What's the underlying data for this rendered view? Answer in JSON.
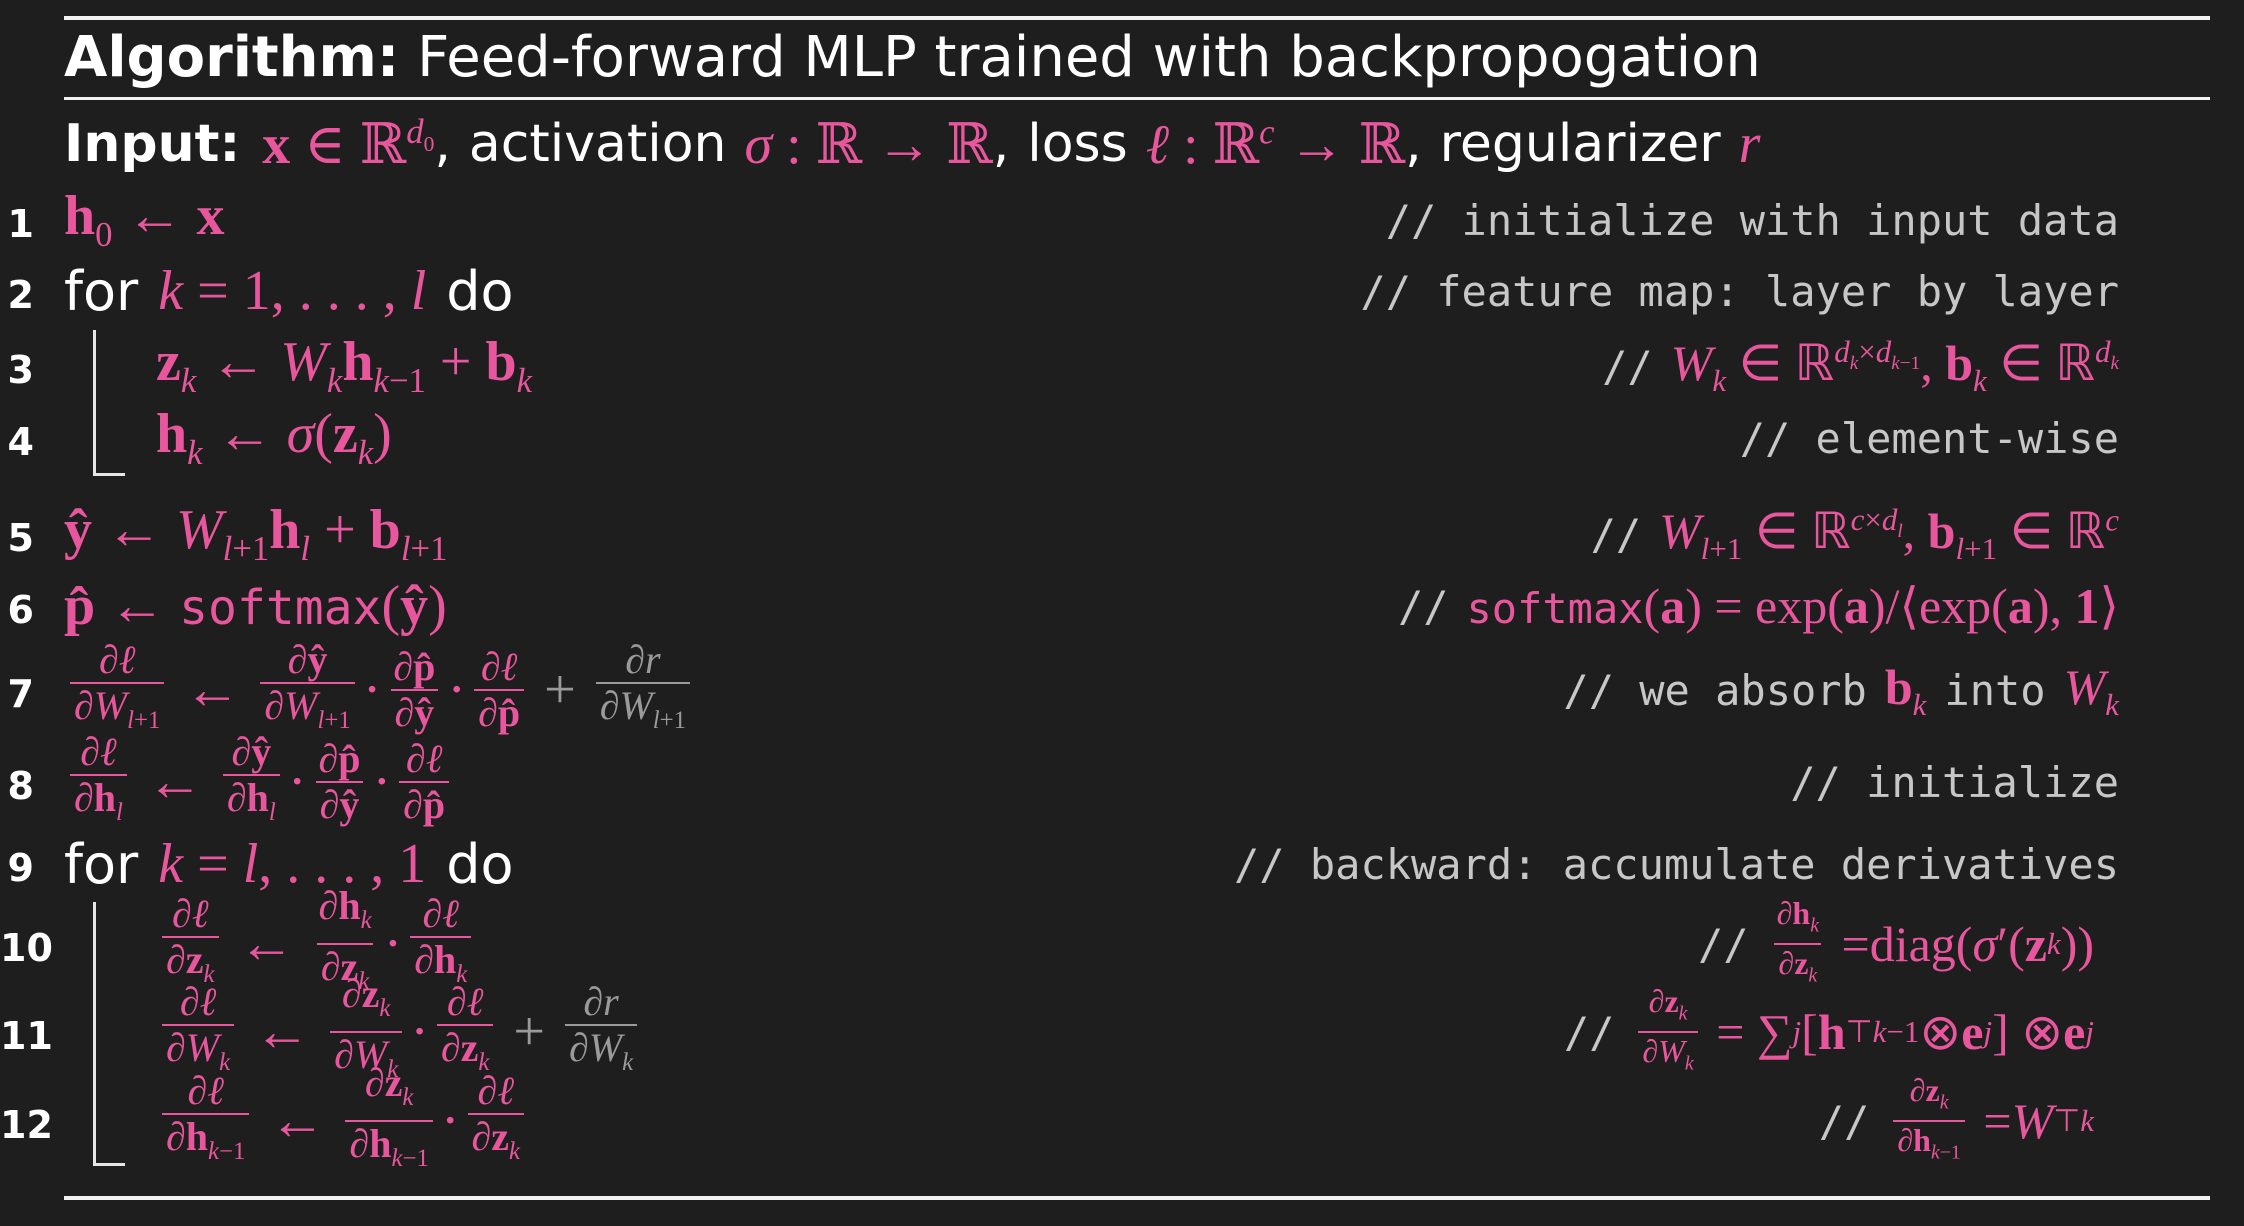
{
  "algorithm": {
    "label": "Algorithm:",
    "title": "Feed-forward MLP trained with backpropogation"
  },
  "input": {
    "label": "Input:",
    "x_desc": "x ∈ ℝ^{d0}",
    "activation_label": "activation",
    "loss_label": "loss",
    "regularizer_label": "regularizer"
  },
  "keywords": {
    "for": "for",
    "do": "do",
    "softmax": "softmax"
  },
  "lines": [
    {
      "num": "1",
      "comment": "// initialize with input data"
    },
    {
      "num": "2",
      "comment": "// feature map:  layer by layer"
    },
    {
      "num": "3",
      "comment": "// W_k ∈ ℝ^{d_k×d_{k−1}}, b_k ∈ ℝ^{d_k}"
    },
    {
      "num": "4",
      "comment": "// element-wise"
    },
    {
      "num": "5",
      "comment": "// W_{l+1} ∈ ℝ^{c×d_l}, b_{l+1} ∈ ℝ^c"
    },
    {
      "num": "6",
      "comment": "// softmax(a) = exp(a)/⟨exp(a), 1⟩"
    },
    {
      "num": "7",
      "comment": "// we absorb b_k into W_k"
    },
    {
      "num": "8",
      "comment": "// initialize"
    },
    {
      "num": "9",
      "comment": "// backward:  accumulate derivatives"
    },
    {
      "num": "10",
      "comment": "// ∂h_k/∂z_k = diag(σ′(z_k))"
    },
    {
      "num": "11",
      "comment": "// ∂z_k/∂W_k = Σ_j [h_{k−1}^⊤ ⊗ e_j] ⊗ e_j"
    },
    {
      "num": "12",
      "comment": "// ∂z_k/∂h_{k−1} = W_k^⊤"
    }
  ],
  "comment_text": {
    "c1": "// initialize with input data",
    "c2": "// feature map:  layer by layer",
    "c4": "// element-wise",
    "c7a": "// we absorb",
    "c7b": "into",
    "c8": "// initialize",
    "c9": "// backward:  accumulate derivatives",
    "slashes": "//",
    "diag": "diag",
    "exp": "exp"
  },
  "colors": {
    "background": "#1e1e1e",
    "math_pink": "#e8579d",
    "comment_gray": "#c7c7c7",
    "regularizer_gray": "#9a9a9a",
    "text_white": "#ffffff"
  }
}
